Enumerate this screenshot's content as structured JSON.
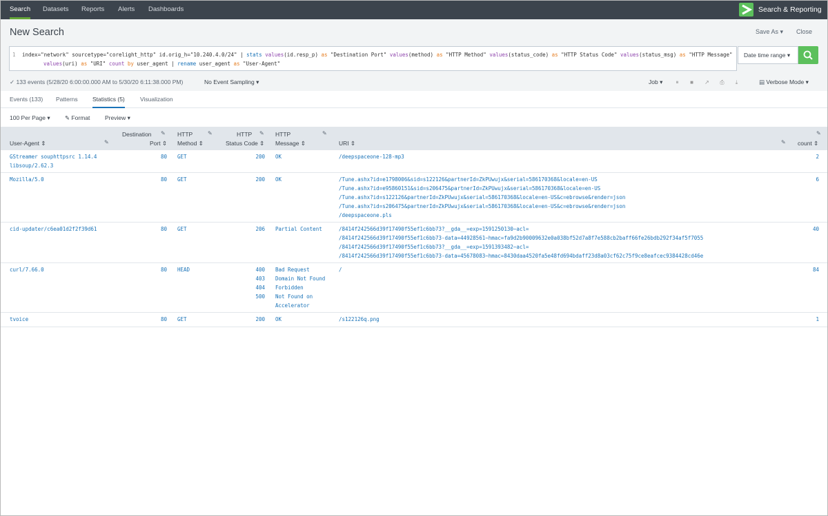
{
  "nav": {
    "items": [
      "Search",
      "Datasets",
      "Reports",
      "Alerts",
      "Dashboards"
    ],
    "app_name": "Search & Reporting"
  },
  "title": {
    "page_title": "New Search",
    "save_as": "Save As ▾",
    "close": "Close"
  },
  "search": {
    "line_number": "1",
    "time_range": "Date time range ▾"
  },
  "status": {
    "event_count": "✓ 133 events (5/28/20 6:00:00.000 AM to 5/30/20 6:11:38.000 PM)",
    "sampling": "No Event Sampling ▾",
    "job": "Job ▾",
    "mode": "Verbose Mode ▾"
  },
  "tabs": [
    "Events (133)",
    "Patterns",
    "Statistics (5)",
    "Visualization"
  ],
  "toolbar": {
    "per_page": "100 Per Page ▾",
    "format": "Format",
    "preview": "Preview ▾"
  },
  "columns": {
    "user_agent": "User-Agent ⇕",
    "dest_port_1": "Destination",
    "dest_port_2": "Port ⇕",
    "method_1": "HTTP",
    "method_2": "Method ⇕",
    "status_1": "HTTP",
    "status_2": "Status Code ⇕",
    "message_1": "HTTP",
    "message_2": "Message ⇕",
    "uri": "URI ⇕",
    "count": "count ⇕"
  },
  "rows": [
    {
      "user_agent": [
        "GStreamer souphttpsrc 1.14.4",
        "libsoup/2.62.3"
      ],
      "port": "80",
      "method": "GET",
      "status": [
        "200"
      ],
      "message": [
        "OK"
      ],
      "uri": [
        "/deepspaceone-128-mp3"
      ],
      "count": "2"
    },
    {
      "user_agent": [
        "Mozilla/5.0"
      ],
      "port": "80",
      "method": "GET",
      "status": [
        "200"
      ],
      "message": [
        "OK"
      ],
      "uri": [
        "/Tune.ashx?id=e1798006&sid=s122126&partnerId=ZkPUwujx&serial=586170368&locale=en-US",
        "/Tune.ashx?id=e95860151&sid=s206475&partnerId=ZkPUwujx&serial=586170368&locale=en-US",
        "/Tune.ashx?id=s122126&partnerId=ZkPUwujx&serial=586170368&locale=en-US&c=ebrowse&render=json",
        "/Tune.ashx?id=s206475&partnerId=ZkPUwujx&serial=586170368&locale=en-US&c=ebrowse&render=json",
        "/deepspaceone.pls"
      ],
      "count": "6"
    },
    {
      "user_agent": [
        "cid-updater/c6ea01d2f2f39d61"
      ],
      "port": "80",
      "method": "GET",
      "status": [
        "206"
      ],
      "message": [
        "Partial Content"
      ],
      "uri": [
        "/8414f242566d39f17490f55ef1c6bb73?__gda__=exp=1591250130~acl=",
        "/8414f242566d39f17490f55ef1c6bb73-data=44928561~hmac=fa9d2b90009632e0a038bf52d7a8f7e588cb2baff66fe26bdb292f34af5f7055",
        "/8414f242566d39f17490f55ef1c6bb73?__gda__=exp=1591393482~acl=",
        "/8414f242566d39f17490f55ef1c6bb73-data=45678083~hmac=8430daa4520fa5e48fd694bdaff23d8a03cf62c75f9ce8eafcec9384428cd46e"
      ],
      "count": "40"
    },
    {
      "user_agent": [
        "curl/7.66.0"
      ],
      "port": "80",
      "method": "HEAD",
      "status": [
        "400",
        "403",
        "404",
        "500"
      ],
      "message": [
        "Bad Request",
        "Domain Not Found",
        "Forbidden",
        "Not Found on",
        "Accelerator"
      ],
      "uri": [
        "/"
      ],
      "count": "84"
    },
    {
      "user_agent": [
        "tvoice"
      ],
      "port": "80",
      "method": "GET",
      "status": [
        "200"
      ],
      "message": [
        "OK"
      ],
      "uri": [
        "/s122126q.png"
      ],
      "count": "1"
    }
  ]
}
